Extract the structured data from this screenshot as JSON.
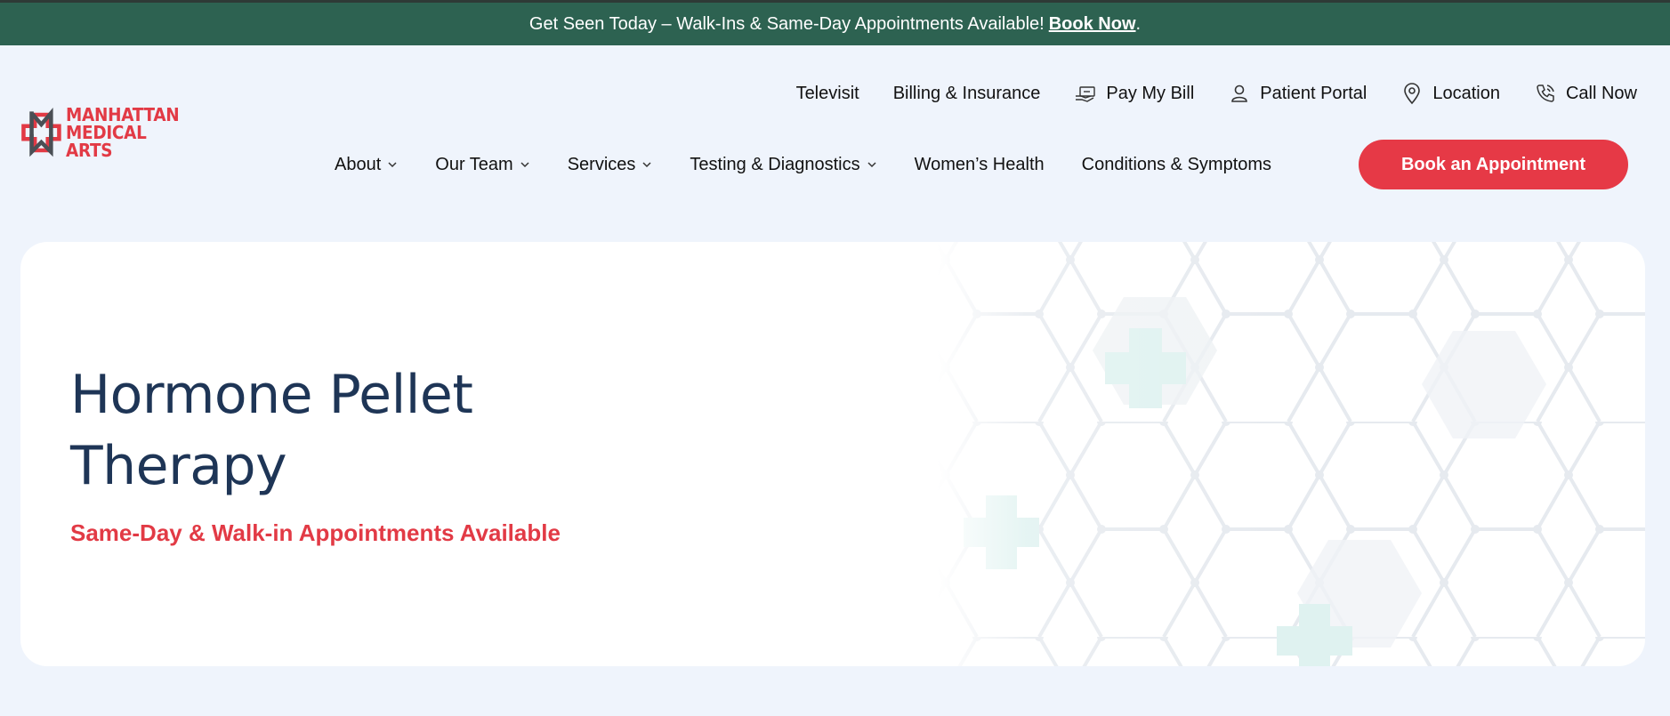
{
  "announcement": {
    "text": "Get Seen Today – Walk-Ins & Same-Day Appointments Available!",
    "link_label": "Book Now",
    "suffix": "."
  },
  "logo": {
    "line1": "MANHATTAN",
    "line2": "MEDICAL ARTS"
  },
  "utility_nav": [
    {
      "label": "Televisit",
      "icon": null
    },
    {
      "label": "Billing & Insurance",
      "icon": null
    },
    {
      "label": "Pay My Bill",
      "icon": "hand-bill-icon"
    },
    {
      "label": "Patient Portal",
      "icon": "user-icon"
    },
    {
      "label": "Location",
      "icon": "map-pin-icon"
    },
    {
      "label": "Call Now",
      "icon": "phone-icon"
    }
  ],
  "main_nav": [
    {
      "label": "About",
      "dropdown": true
    },
    {
      "label": "Our Team",
      "dropdown": true
    },
    {
      "label": "Services",
      "dropdown": true
    },
    {
      "label": "Testing & Diagnostics",
      "dropdown": true
    },
    {
      "label": "Women’s Health",
      "dropdown": false
    },
    {
      "label": "Conditions & Symptoms",
      "dropdown": false
    }
  ],
  "cta_label": "Book an Appointment",
  "hero": {
    "title_line1": "Hormone Pellet",
    "title_line2": "Therapy",
    "subtitle": "Same-Day & Walk-in Appointments Available"
  },
  "colors": {
    "topbar": "#2d6251",
    "brand_red": "#e63946",
    "title_navy": "#1e3556",
    "page_bg": "#eff4fc"
  }
}
